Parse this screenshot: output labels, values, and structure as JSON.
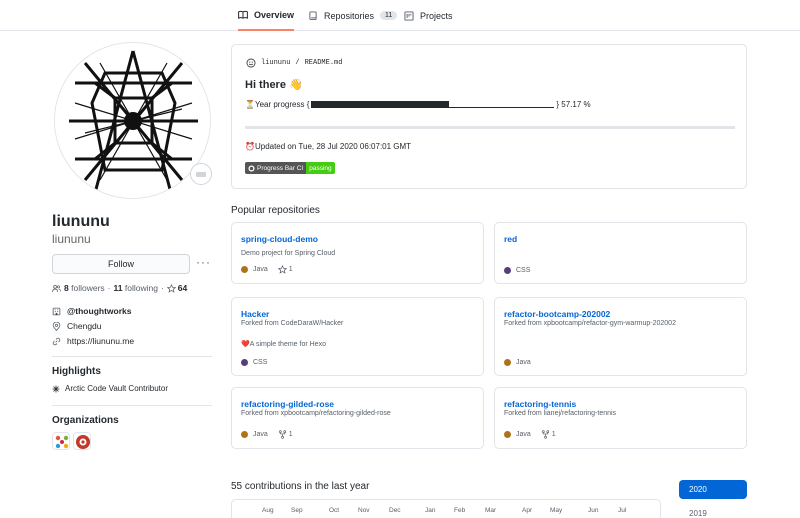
{
  "tabs": [
    {
      "label": "Overview"
    },
    {
      "label": "Repositories",
      "count": "11"
    },
    {
      "label": "Projects"
    }
  ],
  "profile": {
    "name": "liunun u",
    "login": "liununu",
    "follow_label": "Follow",
    "more_label": "···",
    "followers_count": "8",
    "followers_label": "followers",
    "following_count": "11",
    "following_label": "following",
    "separator": "·",
    "stars_count": "64",
    "org": "@thoughtworks",
    "location": "Chengdu",
    "website": "https://liununu.me"
  },
  "highlights": {
    "title": "Highlights",
    "items": [
      "Arctic Code Vault Contributor"
    ]
  },
  "organizations": {
    "title": "Organizations"
  },
  "readme": {
    "owner": "liununu",
    "slash": "/",
    "file": "README.md",
    "heading": "Hi there 👋",
    "progress_prefix": "⏳Year progress {",
    "progress_suffix": "} 57.17 %",
    "progress_percent": 57.17,
    "updated": "⏰Updated on Tue, 28 Jul 2020 06:07:01 GMT",
    "badge_left": "Progress Bar CI",
    "badge_right": "passing"
  },
  "popular": {
    "title": "Popular repositories",
    "repos": [
      {
        "name": "spring-cloud-demo",
        "desc": "Demo project for Spring Cloud",
        "lang": "Java",
        "lang_color": "#b07219",
        "stars": "1"
      },
      {
        "name": "red",
        "desc": "",
        "lang": "CSS",
        "lang_color": "#563d7c"
      },
      {
        "name": "Hacker",
        "fork": "Forked from CodeDaraW/Hacker",
        "desc": "❤️A simple theme for Hexo",
        "lang": "CSS",
        "lang_color": "#563d7c"
      },
      {
        "name": "refactor-bootcamp-202002",
        "fork": "Forked from xpbootcamp/refactor-gym-warmup-202002",
        "lang": "Java",
        "lang_color": "#b07219"
      },
      {
        "name": "refactoring-gilded-rose",
        "fork": "Forked from xpbootcamp/refactoring-gilded-rose",
        "lang": "Java",
        "lang_color": "#b07219",
        "forks": "1"
      },
      {
        "name": "refactoring-tennis",
        "fork": "Forked from lianej/refactoring-tennis",
        "lang": "Java",
        "lang_color": "#b07219",
        "forks": "1"
      }
    ]
  },
  "contributions": {
    "title": "55 contributions in the last year",
    "months": [
      "Aug",
      "Sep",
      "Oct",
      "Nov",
      "Dec",
      "Jan",
      "Feb",
      "Mar",
      "Apr",
      "May",
      "Jun",
      "Jul"
    ],
    "years": [
      "2020",
      "2019"
    ]
  }
}
